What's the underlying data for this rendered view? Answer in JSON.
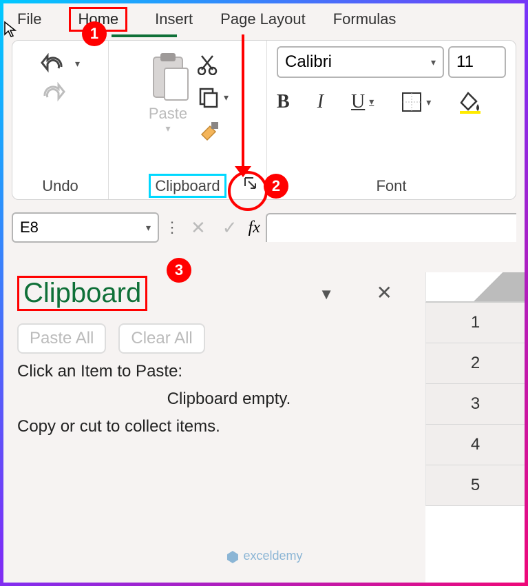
{
  "menubar": {
    "file": "File",
    "home": "Home",
    "insert": "Insert",
    "page_layout": "Page Layout",
    "formulas": "Formulas"
  },
  "ribbon": {
    "undo": {
      "label": "Undo"
    },
    "clipboard": {
      "label": "Clipboard",
      "paste": "Paste"
    },
    "font": {
      "label": "Font",
      "name": "Calibri",
      "size": "11",
      "bold": "B",
      "italic": "I",
      "underline": "U"
    }
  },
  "namebox": {
    "ref": "E8",
    "fx": "fx"
  },
  "pane": {
    "title": "Clipboard",
    "paste_all": "Paste All",
    "clear_all": "Clear All",
    "hint": "Click an Item to Paste:",
    "empty1": "Clipboard empty.",
    "empty2": "Copy or cut to collect items.",
    "opts": "▼",
    "close": "✕"
  },
  "rows": [
    "1",
    "2",
    "3",
    "4",
    "5"
  ],
  "annotations": {
    "b1": "1",
    "b2": "2",
    "b3": "3"
  },
  "watermark": "exceldemy"
}
